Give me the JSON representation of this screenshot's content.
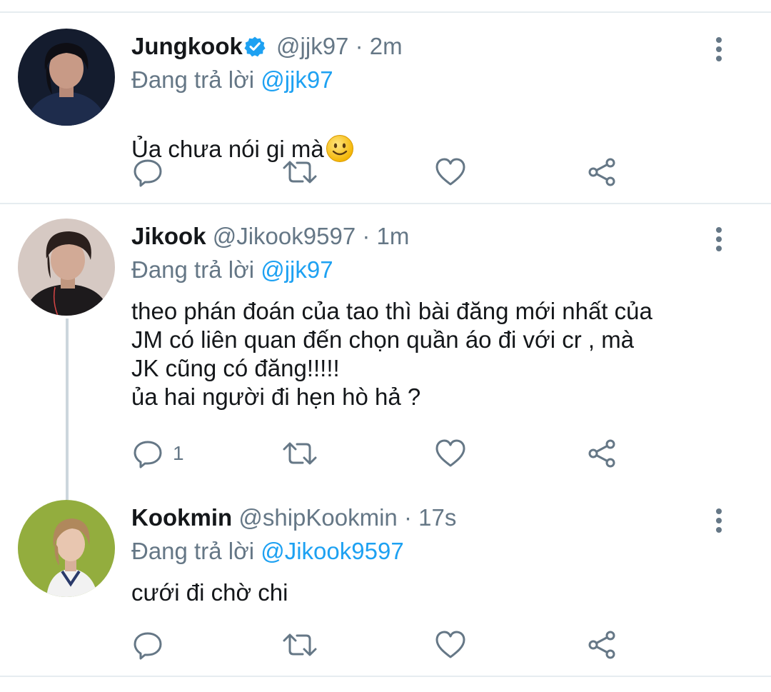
{
  "tweets": [
    {
      "name": "Jungkook",
      "verified": true,
      "handle": "@jjk97",
      "dot": "·",
      "time": "2m",
      "replying_prefix": "Đang trả lời",
      "replying_to": "@jjk97",
      "text": "Ủa chưa nói gi mà",
      "emoji": "slightly-smiling-face",
      "reply_count": "",
      "avatar_colors": {
        "bg": "#141c2e",
        "skin": "#c89a86",
        "hair": "#0e0e14",
        "clothes": "#1e2c4c"
      }
    },
    {
      "name": "Jikook",
      "verified": false,
      "handle": "@Jikook9597",
      "dot": "·",
      "time": "1m",
      "replying_prefix": "Đang trả lời",
      "replying_to": "@jjk97",
      "text": "theo phán đoán của tao thì bài đăng mới nhất của\nJM có liên quan đến chọn quần áo đi với cr ,  mà\nJK cũng có đăng!!!!!\nủa hai người đi hẹn hò hả ?",
      "reply_count": "1",
      "avatar_colors": {
        "bg": "#d6c9c3",
        "skin": "#d2aa96",
        "hair": "#2a1f1c",
        "clothes": "#1d1a1c"
      }
    },
    {
      "name": "Kookmin",
      "verified": false,
      "handle": "@shipKookmin",
      "dot": "·",
      "time": "17s",
      "replying_prefix": "Đang trả lời",
      "replying_to": "@Jikook9597",
      "text": "cưới đi chờ chi",
      "reply_count": "",
      "avatar_colors": {
        "bg": "#93ad3e",
        "skin": "#e8c6b0",
        "hair": "#b0885c",
        "clothes": "#f2f2f2"
      }
    }
  ],
  "icons": {
    "more": "more-vertical-icon",
    "reply": "reply-icon",
    "retweet": "retweet-icon",
    "like": "heart-icon",
    "share": "share-icon",
    "verified": "verified-badge-icon"
  },
  "colors": {
    "accent": "#1da1f2",
    "secondary_text": "#657786",
    "divider": "#e6ecf0",
    "thread_line": "#ccd6dd"
  }
}
